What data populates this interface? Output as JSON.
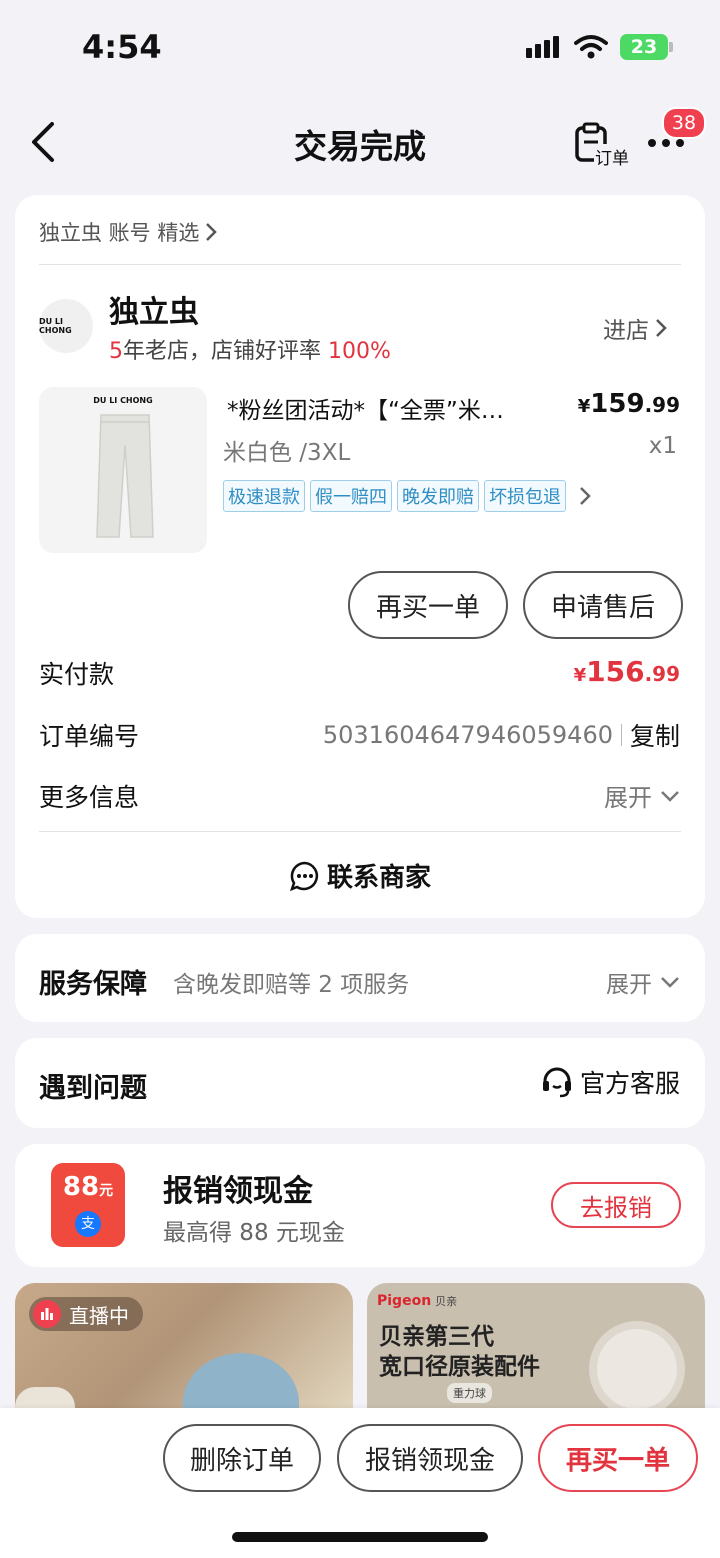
{
  "status_bar": {
    "time": "4:54",
    "battery": "23"
  },
  "nav": {
    "title": "交易完成",
    "order_label": "订单",
    "badge": "38"
  },
  "store": {
    "breadcrumb": "独立虫 账号 精选",
    "logo_text": "DU LI CHONG",
    "name": "独立虫",
    "years": "5",
    "years_suffix": "年老店，店铺好评率",
    "rating": "100%",
    "enter_label": "进店"
  },
  "product": {
    "image_brand": "DU LI CHONG",
    "title": "*粉丝团活动*【“全票”米…",
    "price_symbol": "¥",
    "price_int": "159",
    "price_dec": ".99",
    "variant": "米白色 /3XL",
    "quantity": "x1",
    "tags": [
      "极速退款",
      "假一赔四",
      "晚发即赔",
      "坏损包退"
    ]
  },
  "actions": {
    "rebuy": "再买一单",
    "after_sale": "申请售后"
  },
  "payment": {
    "label": "实付款",
    "symbol": "¥",
    "amount_int": "156",
    "amount_dec": ".99"
  },
  "order": {
    "number_label": "订单编号",
    "number": "5031604647946059460",
    "copy": "复制",
    "more_label": "更多信息",
    "expand": "展开",
    "contact": "联系商家"
  },
  "service": {
    "title": "服务保障",
    "desc": "含晚发即赔等 2 项服务",
    "expand": "展开"
  },
  "problem": {
    "title": "遇到问题",
    "support": "官方客服"
  },
  "cashback": {
    "icon_value": "88",
    "icon_unit": "元",
    "icon_sub": "支",
    "title": "报销领现金",
    "desc": "最高得 88 元现金",
    "button": "去报销"
  },
  "feed": {
    "live_badge": "直播中",
    "ad_brand": "Pigeon",
    "ad_brand_cn": "贝亲",
    "ad_line1": "贝亲第三代",
    "ad_line2": "宽口径原装配件",
    "ad_tag": "重力球"
  },
  "bottom_bar": {
    "delete": "删除订单",
    "cashback": "报销领现金",
    "rebuy": "再买一单"
  },
  "colors": {
    "accent": "#e2343f",
    "tag_blue": "#2f8ec3",
    "background": "#f2f2f7"
  }
}
